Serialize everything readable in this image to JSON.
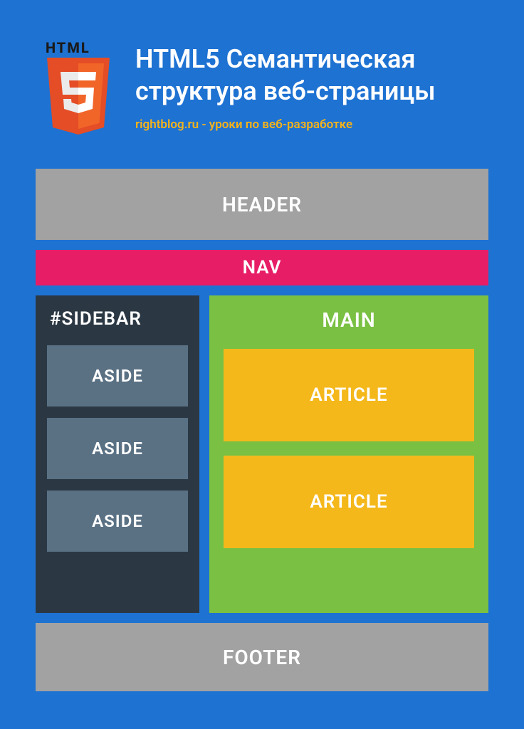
{
  "logo": {
    "label": "HTML"
  },
  "title": "HTML5 Семантическая структура веб-страницы",
  "subtitle": "rightblog.ru - уроки по веб-разработке",
  "layout": {
    "header": "HEADER",
    "nav": "NAV",
    "sidebar": {
      "title": "#SIDEBAR",
      "asides": [
        "ASIDE",
        "ASIDE",
        "ASIDE"
      ]
    },
    "main": {
      "title": "MAIN",
      "articles": [
        "ARTICLE",
        "ARTICLE"
      ]
    },
    "footer": "FOOTER"
  },
  "colors": {
    "background": "#1e72d2",
    "header_footer": "#a2a2a2",
    "nav": "#e71d66",
    "sidebar": "#2b3844",
    "aside": "#5a7184",
    "main": "#7ac043",
    "article": "#f4b81b",
    "accent": "#f5b31a"
  }
}
